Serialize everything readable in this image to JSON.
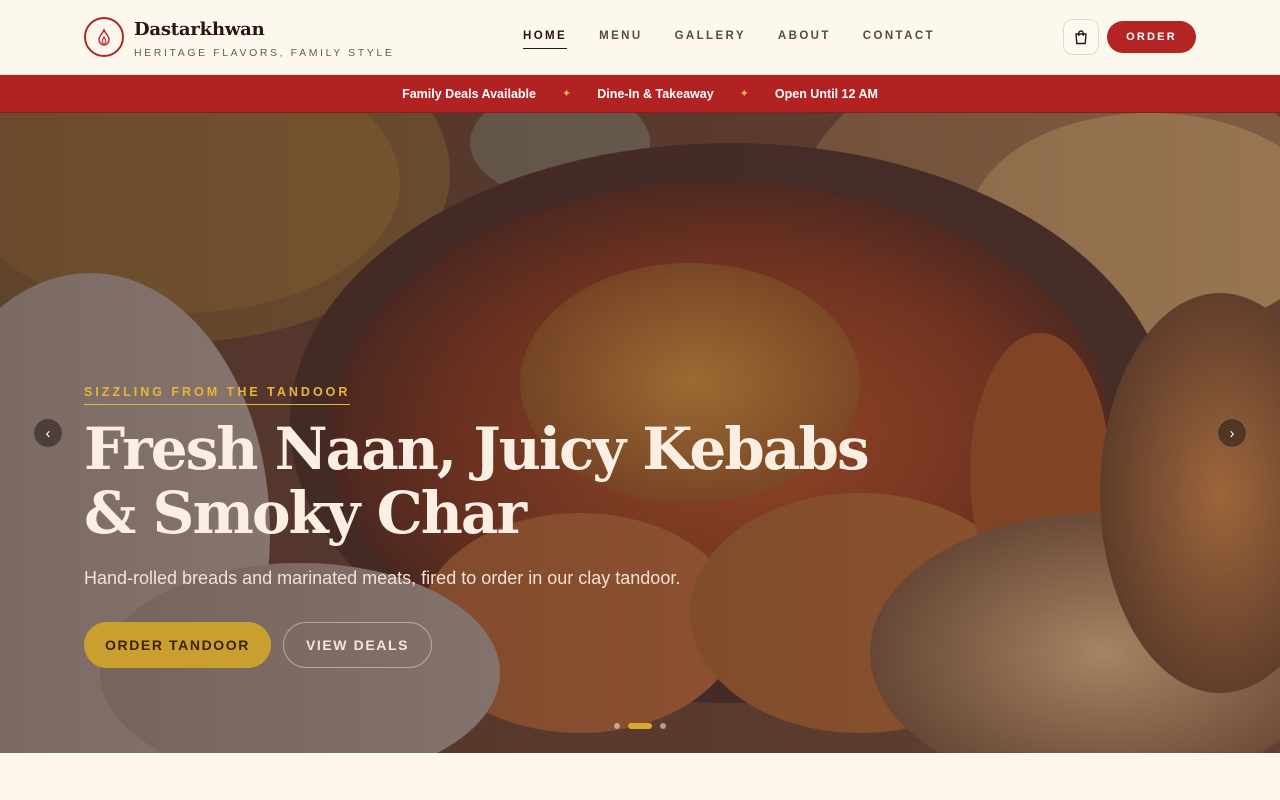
{
  "brand": {
    "name": "Dastarkhwan",
    "tagline": "HERITAGE FLAVORS, FAMILY STYLE",
    "accent": "#b42424",
    "icon": "flame-icon"
  },
  "nav": {
    "items": [
      {
        "label": "HOME",
        "active": true
      },
      {
        "label": "MENU",
        "active": false
      },
      {
        "label": "GALLERY",
        "active": false
      },
      {
        "label": "ABOUT",
        "active": false
      },
      {
        "label": "CONTACT",
        "active": false
      }
    ]
  },
  "header_actions": {
    "cart_icon": "shopping-bag-icon",
    "order_label": "ORDER"
  },
  "ticker": {
    "items": [
      "Family Deals Available",
      "Dine-In & Takeaway",
      "Open Until 12 AM"
    ],
    "separator": "✦",
    "background": "#b22222"
  },
  "hero": {
    "eyebrow": "SIZZLING FROM THE TANDOOR",
    "headline": "Fresh Naan, Juicy Kebabs & Smoky Char",
    "subtitle": "Hand-rolled breads and marinated meats, fired to order in our clay tandoor.",
    "primary_cta": "ORDER TANDOOR",
    "secondary_cta": "VIEW DEALS",
    "prev_arrow": "‹",
    "next_arrow": "›",
    "slides_count": 3,
    "active_slide": 2,
    "gold": "#c9a030"
  }
}
